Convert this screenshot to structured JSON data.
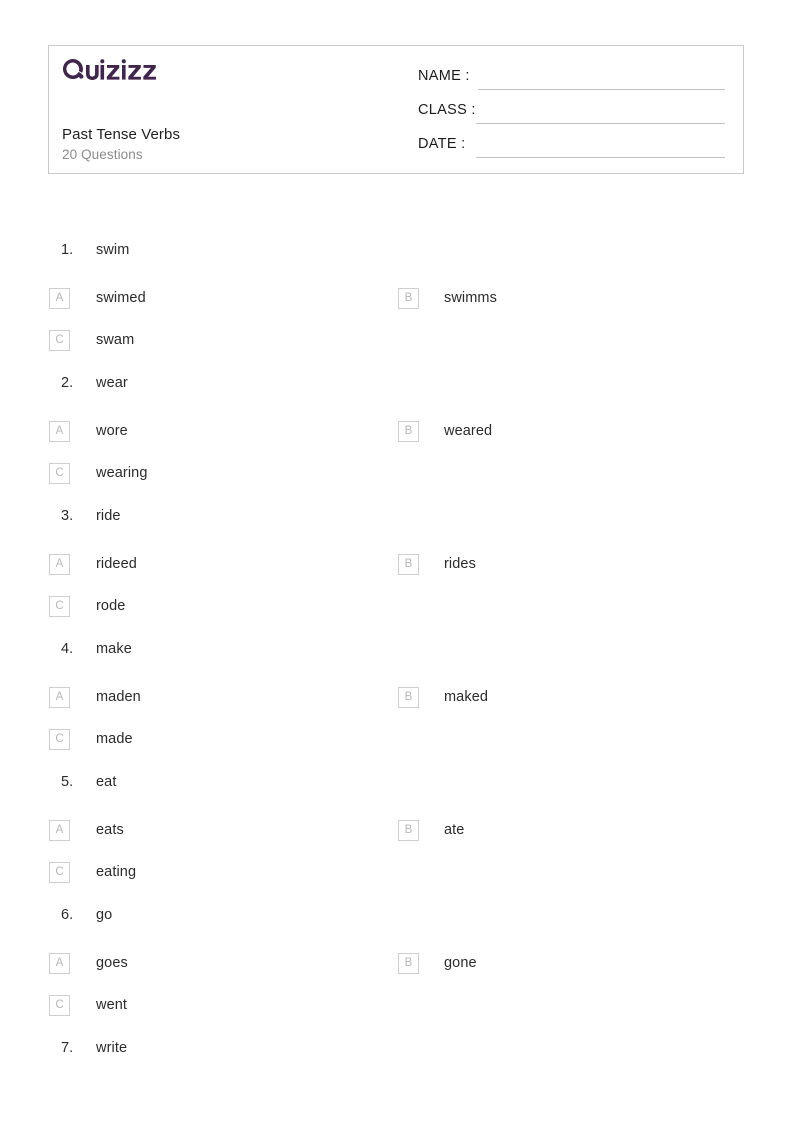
{
  "header": {
    "logo_name": "quizizz-logo",
    "logo_text": "Quizizz",
    "logo_color": "#41254c",
    "title": "Past Tense Verbs",
    "subtitle": "20 Questions",
    "fields": [
      {
        "label": "NAME :",
        "value": ""
      },
      {
        "label": "CLASS :",
        "value": ""
      },
      {
        "label": "DATE  :",
        "value": ""
      }
    ]
  },
  "questions": [
    {
      "number": "1.",
      "text": "swim",
      "options": [
        {
          "letter": "A",
          "text": "swimed"
        },
        {
          "letter": "B",
          "text": "swimms"
        },
        {
          "letter": "C",
          "text": "swam"
        }
      ]
    },
    {
      "number": "2.",
      "text": "wear",
      "options": [
        {
          "letter": "A",
          "text": "wore"
        },
        {
          "letter": "B",
          "text": "weared"
        },
        {
          "letter": "C",
          "text": "wearing"
        }
      ]
    },
    {
      "number": "3.",
      "text": "ride",
      "options": [
        {
          "letter": "A",
          "text": "rideed"
        },
        {
          "letter": "B",
          "text": "rides"
        },
        {
          "letter": "C",
          "text": "rode"
        }
      ]
    },
    {
      "number": "4.",
      "text": "make",
      "options": [
        {
          "letter": "A",
          "text": "maden"
        },
        {
          "letter": "B",
          "text": "maked"
        },
        {
          "letter": "C",
          "text": "made"
        }
      ]
    },
    {
      "number": "5.",
      "text": "eat",
      "options": [
        {
          "letter": "A",
          "text": "eats"
        },
        {
          "letter": "B",
          "text": "ate"
        },
        {
          "letter": "C",
          "text": "eating"
        }
      ]
    },
    {
      "number": "6.",
      "text": "go",
      "options": [
        {
          "letter": "A",
          "text": "goes"
        },
        {
          "letter": "B",
          "text": "gone"
        },
        {
          "letter": "C",
          "text": "went"
        }
      ]
    },
    {
      "number": "7.",
      "text": "write",
      "options": []
    }
  ],
  "colors": {
    "text": "#2b2b2b",
    "muted": "#8b8b8b",
    "badge_border": "#cfcfcf",
    "badge_text": "#b7b7b7",
    "card_border": "#c9c9c9",
    "line": "#c2c2c2",
    "background": "#ffffff"
  }
}
